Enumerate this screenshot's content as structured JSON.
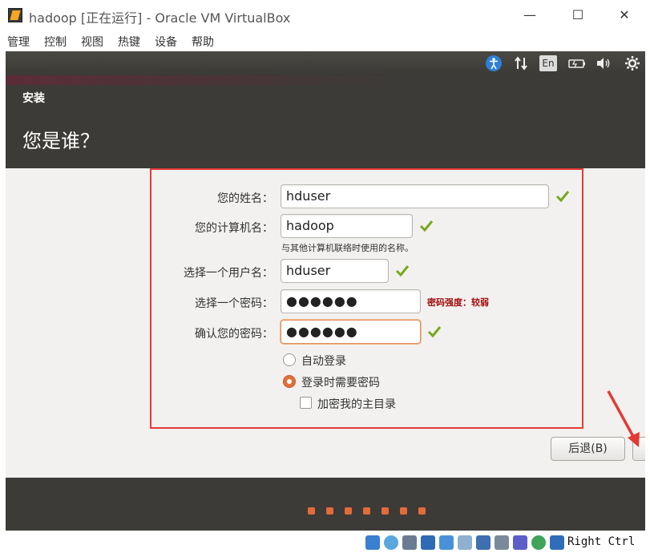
{
  "window": {
    "title": "hadoop [正在运行] - Oracle VM VirtualBox",
    "minimize_glyph": "—",
    "maximize_glyph": "☐",
    "close_glyph": "✕"
  },
  "menubar": [
    "管理",
    "控制",
    "视图",
    "热键",
    "设备",
    "帮助"
  ],
  "vm_topbar": {
    "language": "En",
    "icons": [
      "accessibility-icon",
      "network-icon",
      "keyboard-language-icon",
      "battery-icon",
      "volume-icon",
      "settings-gear-icon"
    ]
  },
  "installer": {
    "section": "安装",
    "heading": "您是谁？",
    "fields": {
      "name_label": "您的姓名：",
      "name_value": "hduser",
      "computer_label": "您的计算机名：",
      "computer_value": "hadoop",
      "computer_hint": "与其他计算机联络时使用的名称。",
      "username_label": "选择一个用户名：",
      "username_value": "hduser",
      "password_label": "选择一个密码：",
      "password_value": "●●●●●●",
      "password_strength": "密码强度：较弱",
      "confirm_label": "确认您的密码：",
      "confirm_value": "●●●●●●"
    },
    "options": {
      "auto_login": "自动登录",
      "require_password": "登录时需要密码",
      "encrypt_home": "加密我的主目录"
    },
    "buttons": {
      "back": "后退(B)"
    },
    "progress_dots": 7
  },
  "statusbar": {
    "host_key": "Right Ctrl"
  },
  "colors": {
    "accent": "#e26b3a",
    "highlight_box": "#e53935",
    "header_bg": "#3c3b37"
  }
}
